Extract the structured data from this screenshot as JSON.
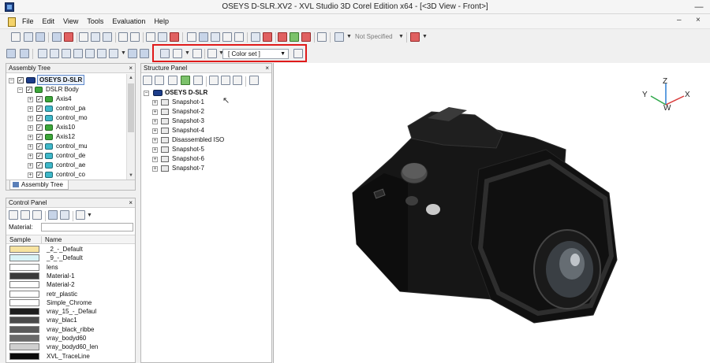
{
  "window": {
    "title": "OSEYS D-SLR.XV2 - XVL Studio 3D Corel Edition x64 - [<3D View - Front>]",
    "minimize": "—"
  },
  "menubar": {
    "items": [
      "File",
      "Edit",
      "View",
      "Tools",
      "Evaluation",
      "Help"
    ],
    "mdi_min": "–",
    "mdi_close": "×"
  },
  "toolbar": {
    "not_specified": "Not Specified",
    "color_set": "[ Color set ]"
  },
  "assembly_tree": {
    "title": "Assembly Tree",
    "close": "×",
    "tab": "Assembly Tree",
    "items": [
      {
        "label": "OSEYS D-SLR",
        "level": 0,
        "icon": "xvl-icon"
      },
      {
        "label": "DSLR Body",
        "level": 1,
        "icon": "green-part-icon"
      },
      {
        "label": "Axis4",
        "level": 2,
        "icon": "green-part-icon"
      },
      {
        "label": "control_pa",
        "level": 2,
        "icon": "cyan-part-icon"
      },
      {
        "label": "control_mo",
        "level": 2,
        "icon": "cyan-part-icon"
      },
      {
        "label": "Axis10",
        "level": 2,
        "icon": "green-part-icon"
      },
      {
        "label": "Axis12",
        "level": 2,
        "icon": "green-part-icon"
      },
      {
        "label": "control_mu",
        "level": 2,
        "icon": "cyan-part-icon"
      },
      {
        "label": "control_de",
        "level": 2,
        "icon": "cyan-part-icon"
      },
      {
        "label": "control_ae",
        "level": 2,
        "icon": "cyan-part-icon"
      },
      {
        "label": "control_co",
        "level": 2,
        "icon": "cyan-part-icon"
      }
    ]
  },
  "control_panel": {
    "title": "Control Panel",
    "close": "×",
    "material_label": "Material:",
    "col_sample": "Sample",
    "col_name": "Name",
    "materials": [
      {
        "name": "_2_-_Default",
        "color": "#f7e3a0"
      },
      {
        "name": "_9_-_Default",
        "color": "#d9f3f6"
      },
      {
        "name": "lens",
        "color": "#ffffff"
      },
      {
        "name": "Material-1",
        "color": "#3a3a3a"
      },
      {
        "name": "Material-2",
        "color": "#ffffff"
      },
      {
        "name": "retr_plastic",
        "color": "#ffffff"
      },
      {
        "name": "Simple_Chrome",
        "color": "#ffffff"
      },
      {
        "name": "vray_15_-_Defaul",
        "color": "#1e1e1e"
      },
      {
        "name": "vray_blac1",
        "color": "#4a4a4a"
      },
      {
        "name": "vray_black_ribbe",
        "color": "#5a5a5a"
      },
      {
        "name": "vray_bodyd60",
        "color": "#6a6a6a"
      },
      {
        "name": "vray_bodyd60_len",
        "color": "#cfcfcf"
      },
      {
        "name": "XVL_TraceLine",
        "color": "#0a0a0a"
      }
    ]
  },
  "structure_panel": {
    "title": "Structure Panel",
    "close": "×",
    "root": "OSEYS D-SLR",
    "items": [
      "Snapshot-1",
      "Snapshot-2",
      "Snapshot-3",
      "Snapshot-4",
      "Disassembled ISO",
      "Snapshot-5",
      "Snapshot-6",
      "Snapshot-7"
    ]
  },
  "view3d": {
    "axes": {
      "y": "Y",
      "z": "Z",
      "x": "X",
      "w": "W"
    }
  }
}
